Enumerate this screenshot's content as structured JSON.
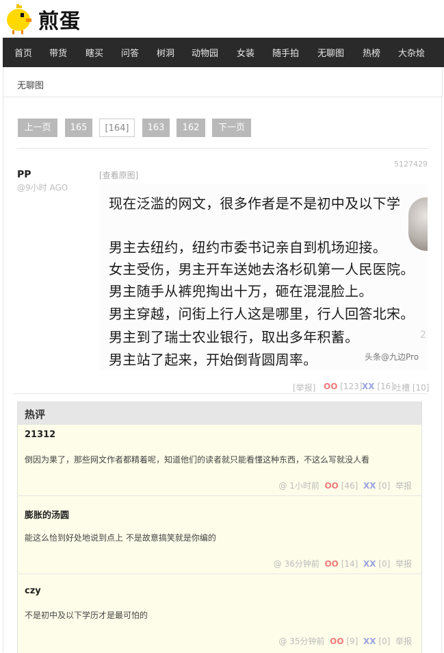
{
  "brand": {
    "logo_text": "煎蛋"
  },
  "nav": {
    "items": [
      "首页",
      "带货",
      "瞎买",
      "问答",
      "树洞",
      "动物园",
      "女装",
      "随手拍",
      "无聊图",
      "热榜",
      "大杂烩"
    ]
  },
  "breadcrumb": "无聊图",
  "pager": {
    "prev": "上一页",
    "p1": "165",
    "current": "[164]",
    "p3": "163",
    "p4": "162",
    "next": "下一页"
  },
  "post": {
    "id": "5127429",
    "author": "PP",
    "time": "@9小时 AGO",
    "view_original": "[查看原图]",
    "image_text": [
      "现在泛滥的网文，很多作者是不是初中及以下学",
      "男主去纽约，纽约市委书记亲自到机场迎接。",
      "女主受伤，男主开车送她去洛杉矶第一人民医院。",
      "男主随手从裤兜掏出十万，砸在混混脸上。",
      "男主穿越，问街上行人这是哪里，行人回答北宋。",
      "男主到了瑞士农业银行，取出多年积蓄。",
      "男主站了起来，开始倒背圆周率。"
    ],
    "watermark": "头条@九边Pro",
    "watermark_side": "2",
    "report": "[举报]",
    "oo_label": "OO",
    "oo_count": "[123]",
    "xx_label": "XX",
    "xx_count": "[16]",
    "tucao": "吐槽 [10]"
  },
  "hot": {
    "title": "热评",
    "comments": [
      {
        "author": "21312",
        "text": "倒因为果了，那些网文作者都精着呢，知道他们的读者就只能看懂这种东西，不这么写就没人看",
        "time": "@  1小时前",
        "oo": "[46]",
        "xx": "[0]",
        "report": "举报"
      },
      {
        "author": "膨胀的汤圆",
        "text": "能这么恰到好处地说到点上 不是故意搞笑就是你编的",
        "time": "@  36分钟前",
        "oo": "[14]",
        "xx": "[0]",
        "report": "举报"
      },
      {
        "author": "czy",
        "text": "不是初中及以下学历才是最可怕的",
        "time": "@  35分钟前",
        "oo": "[9]",
        "xx": "[0]",
        "report": "举报"
      }
    ]
  },
  "colors": {
    "nav_bg": "#2a2a2a",
    "oo": "#f07a7a",
    "xx": "#9aa3e0",
    "hot_bg": "#fefde9"
  }
}
